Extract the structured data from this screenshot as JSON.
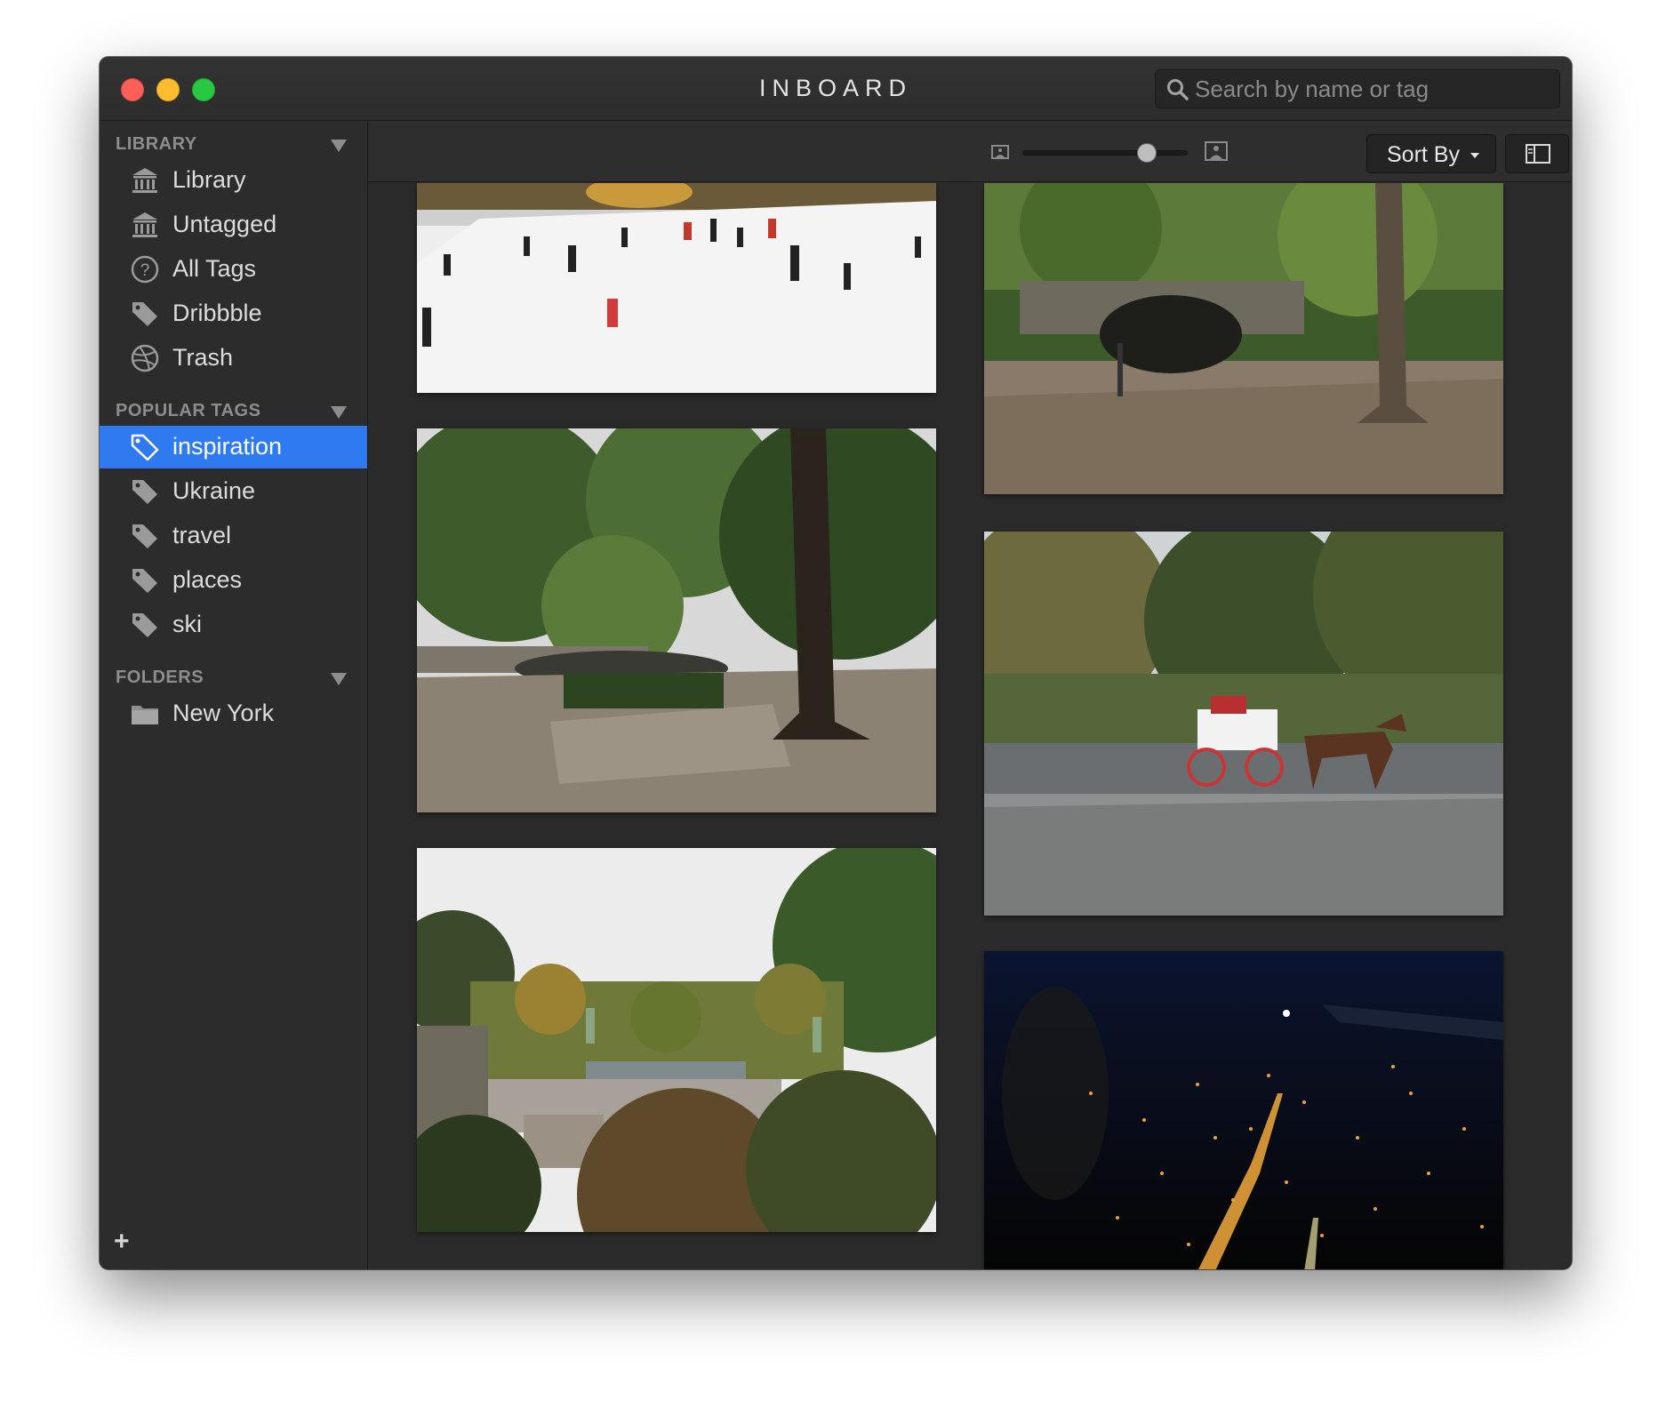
{
  "window": {
    "title": "INBOARD"
  },
  "search": {
    "placeholder": "Search by name or tag"
  },
  "sidebar": {
    "library_header": "LIBRARY",
    "library_items": [
      {
        "label": "Library",
        "icon": "library-icon"
      },
      {
        "label": "Untagged",
        "icon": "library-icon"
      },
      {
        "label": "All Tags",
        "icon": "question-icon"
      },
      {
        "label": "Dribbble",
        "icon": "tag-icon"
      },
      {
        "label": "Trash",
        "icon": "dribbble-icon"
      }
    ],
    "tags_header": "POPULAR TAGS",
    "tag_items": [
      {
        "label": "inspiration",
        "active": true
      },
      {
        "label": "Ukraine"
      },
      {
        "label": "travel"
      },
      {
        "label": "places"
      },
      {
        "label": "ski"
      }
    ],
    "folders_header": "FOLDERS",
    "folder_items": [
      {
        "label": "New York",
        "icon": "folder-icon"
      }
    ],
    "add_label": "+"
  },
  "toolbar": {
    "sort_label": "Sort By",
    "zoom_level": 0.75
  },
  "colors": {
    "accent": "#2f7af0",
    "window_bg": "#2b2b2b",
    "sidebar_bg": "#2c2c2c"
  },
  "photos": [
    {
      "subject": "ice-skating-rink"
    },
    {
      "subject": "park-stone-bridge-tunnel"
    },
    {
      "subject": "park-trees-bridge"
    },
    {
      "subject": "horse-carriage"
    },
    {
      "subject": "bethesda-terrace"
    },
    {
      "subject": "night-city-aerial"
    }
  ]
}
